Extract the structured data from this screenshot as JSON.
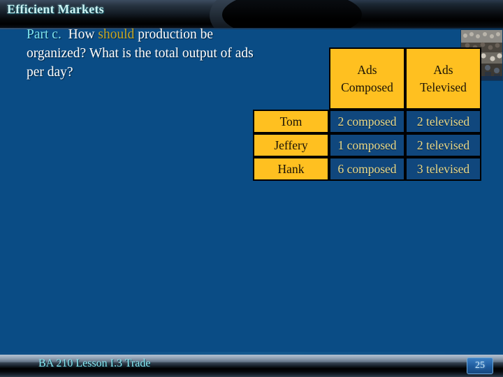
{
  "slide": {
    "title": "Efficient Markets",
    "background_color": "#0A4C85",
    "accent_gold": "#FFC020",
    "accent_cyan": "#7fe6f0"
  },
  "bullet": {
    "label": "Part c.",
    "text_before": "How",
    "emphasis": "should",
    "text_after": "production be organized? What is the total output of ads per day?"
  },
  "table": {
    "corner_label": "",
    "column_headers": [
      "Ads\nComposed",
      "Ads\nTelevised"
    ],
    "column_header_lines": [
      {
        "line1": "Ads",
        "line2": "Composed"
      },
      {
        "line1": "Ads",
        "line2": "Televised"
      }
    ],
    "rows": [
      {
        "name": "Tom",
        "composed": "2 composed",
        "televised": "2 televised"
      },
      {
        "name": "Jeffery",
        "composed": "1 composed",
        "televised": "2 televised"
      },
      {
        "name": "Hank",
        "composed": "6 composed",
        "televised": "3 televised"
      }
    ]
  },
  "footer": {
    "text": "BA 210  Lesson I.3 Trade",
    "page_number": "25"
  },
  "photo": {
    "alt": "crowd-photo-thumbnail"
  }
}
